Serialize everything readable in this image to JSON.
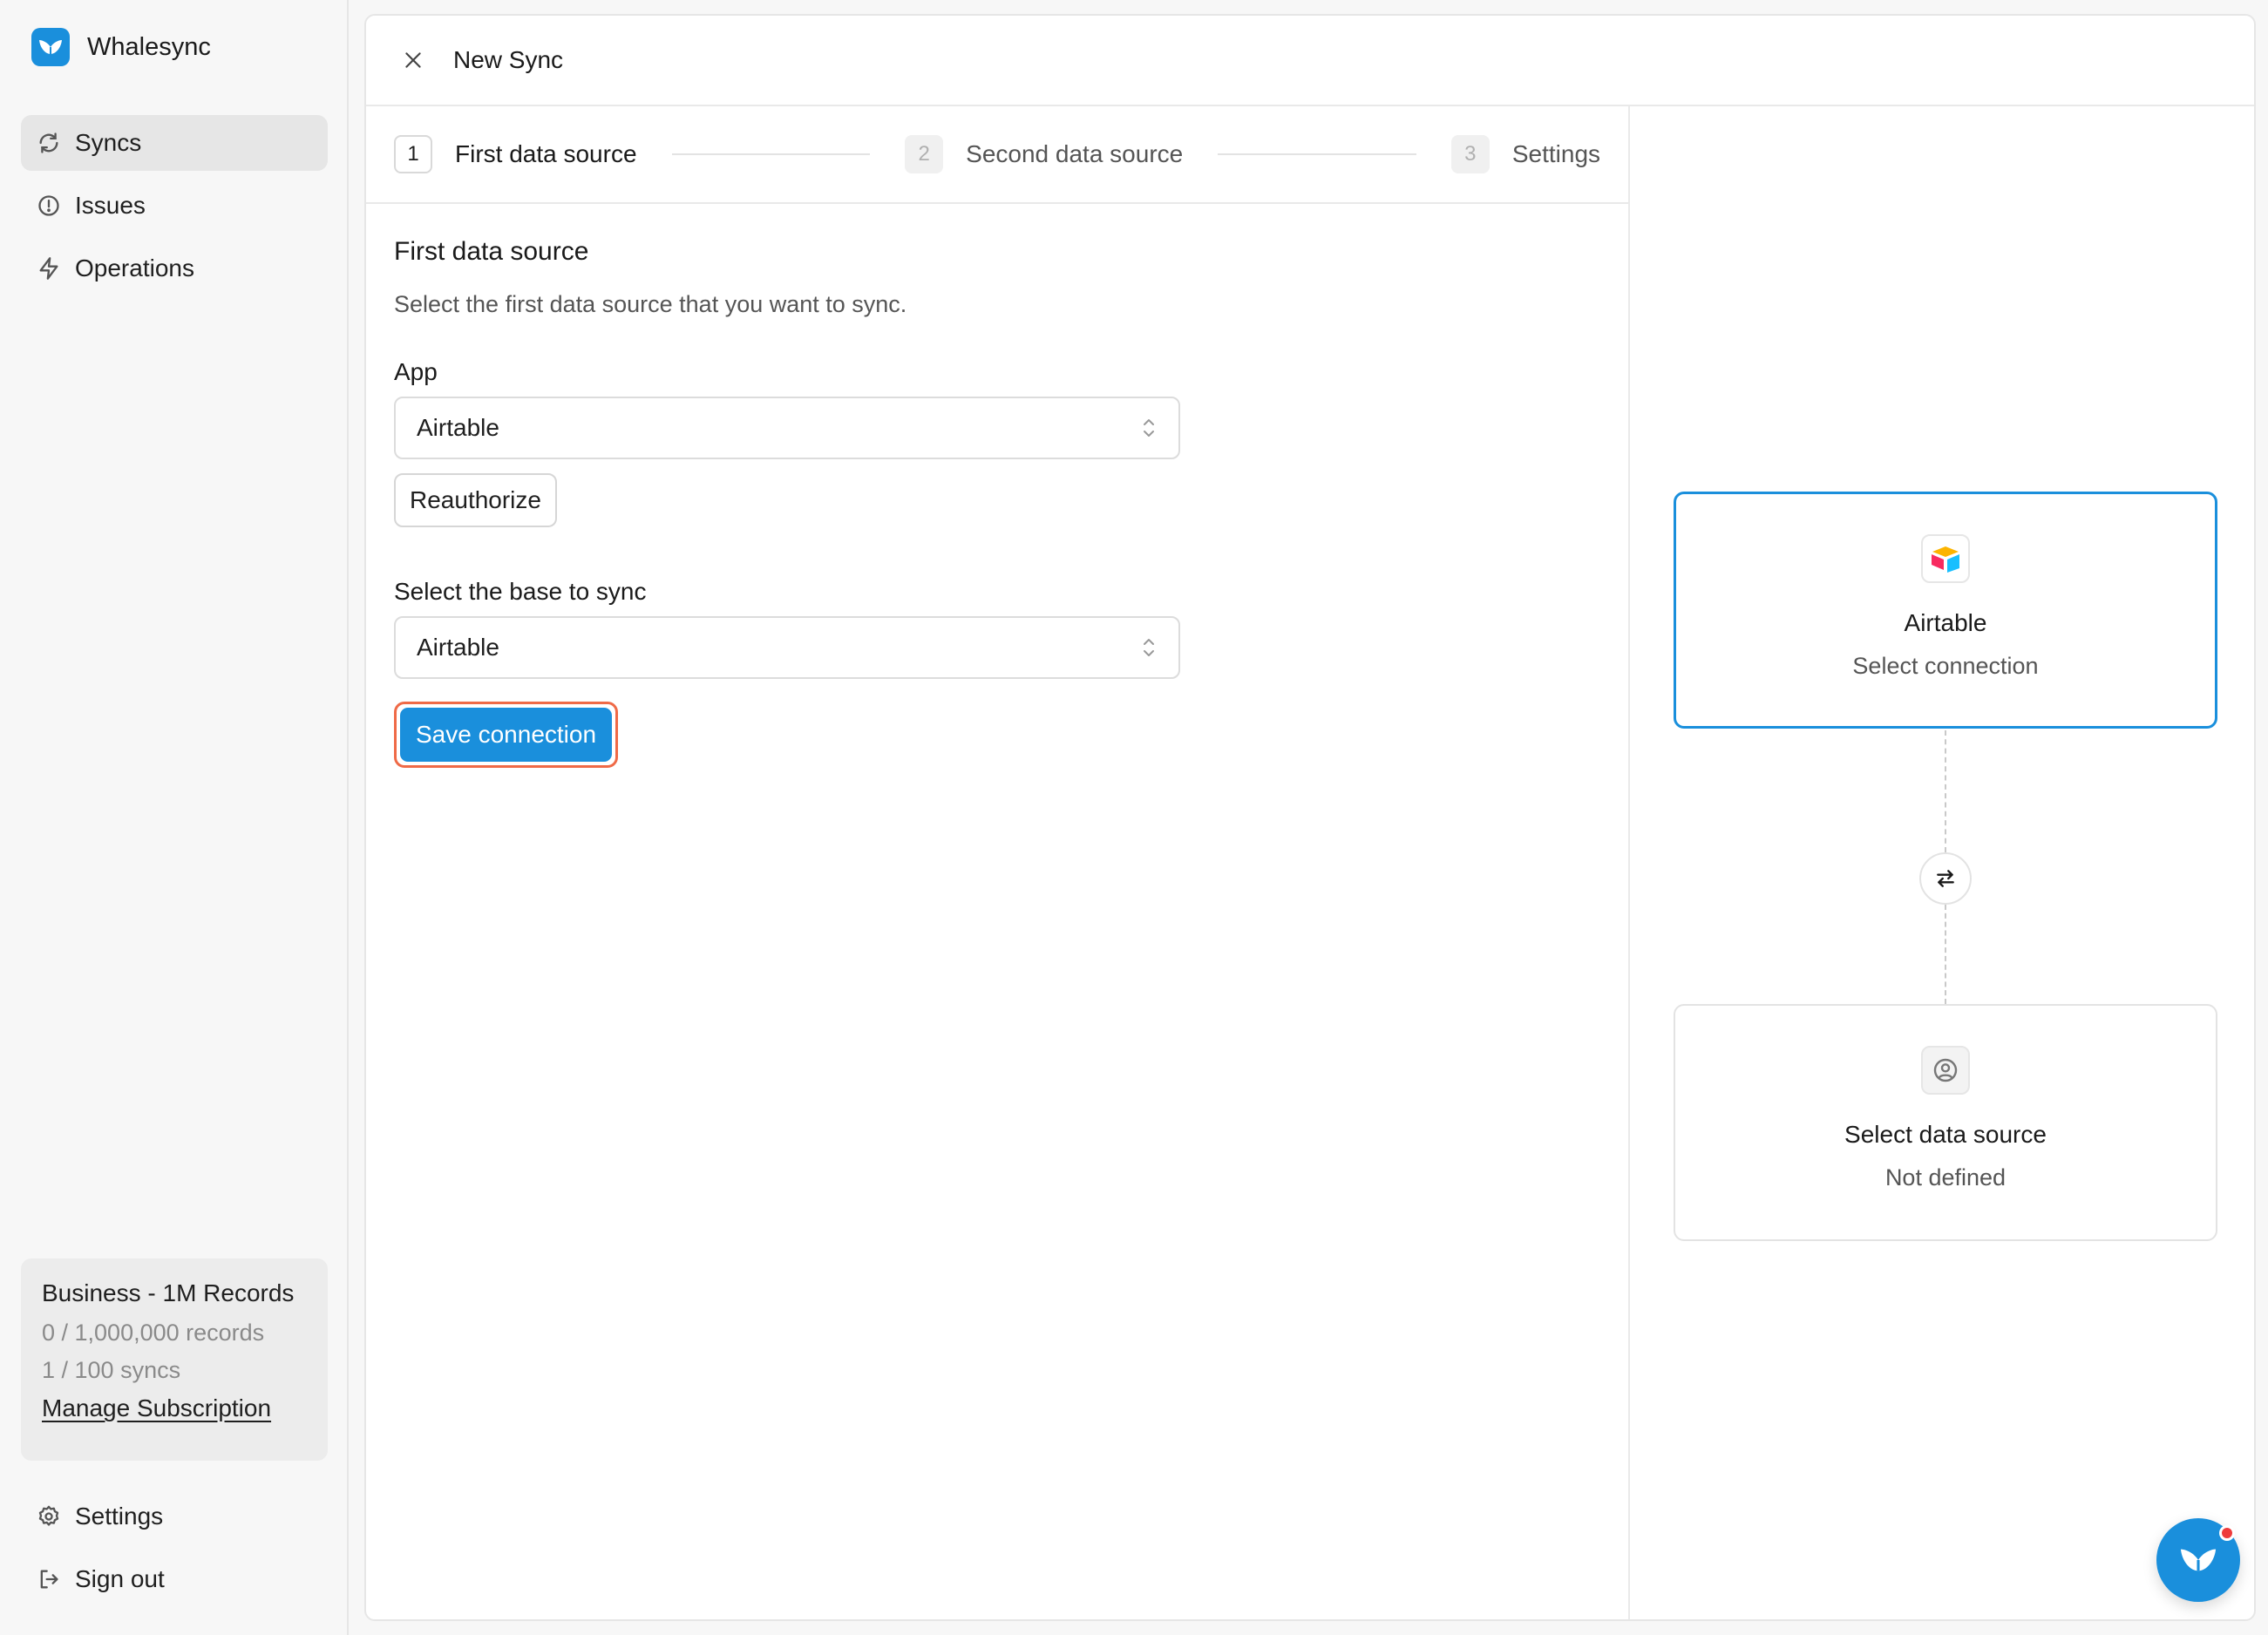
{
  "app": {
    "name": "Whalesync"
  },
  "sidebar": {
    "items": [
      {
        "label": "Syncs",
        "icon": "refresh-icon",
        "active": true
      },
      {
        "label": "Issues",
        "icon": "alert-circle-icon",
        "active": false
      },
      {
        "label": "Operations",
        "icon": "bolt-icon",
        "active": false
      }
    ],
    "plan": {
      "title": "Business - 1M Records",
      "records": "0 / 1,000,000 records",
      "syncs": "1 / 100 syncs",
      "manage_label": "Manage Subscription"
    },
    "bottom": [
      {
        "label": "Settings",
        "icon": "gear-icon"
      },
      {
        "label": "Sign out",
        "icon": "sign-out-icon"
      }
    ]
  },
  "header": {
    "title": "New Sync",
    "close_icon": "close-icon"
  },
  "steps": [
    {
      "num": "1",
      "label": "First data source",
      "state": "active"
    },
    {
      "num": "2",
      "label": "Second data source",
      "state": "inactive"
    },
    {
      "num": "3",
      "label": "Settings",
      "state": "inactive"
    }
  ],
  "form": {
    "title": "First data source",
    "description": "Select the first data source that you want to sync.",
    "app_label": "App",
    "app_value": "Airtable",
    "reauthorize_label": "Reauthorize",
    "base_label": "Select the base to sync",
    "base_value": "Airtable",
    "save_label": "Save connection"
  },
  "diagram": {
    "source_card": {
      "title": "Airtable",
      "subtitle": "Select connection",
      "icon": "airtable-logo-icon"
    },
    "swap_icon": "swap-arrows-icon",
    "target_card": {
      "title": "Select data source",
      "subtitle": "Not defined",
      "icon": "user-circle-icon"
    }
  },
  "colors": {
    "accent": "#1a8fdc",
    "highlight": "#ef6a47",
    "notification": "#ee3b3b"
  }
}
